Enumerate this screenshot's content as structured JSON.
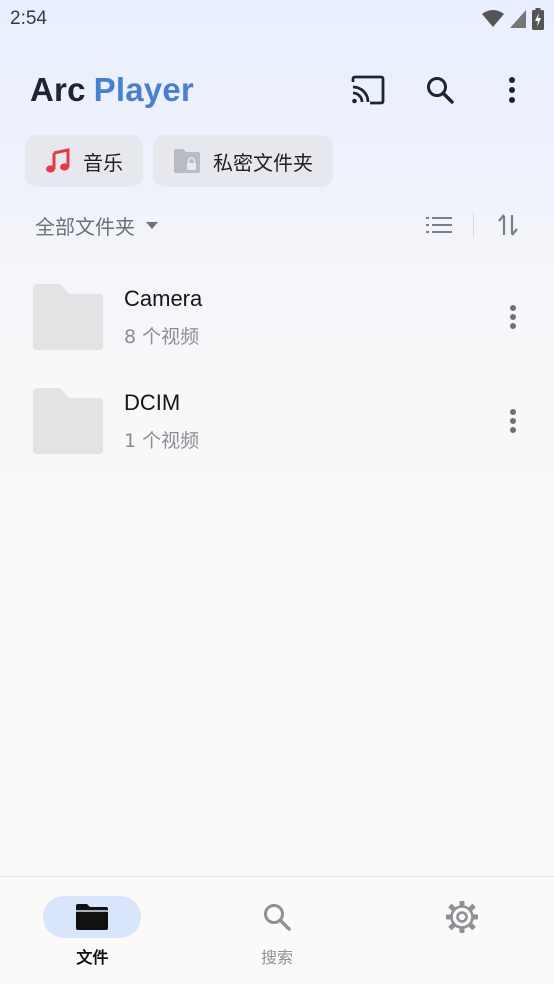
{
  "status_bar": {
    "time": "2:54"
  },
  "header": {
    "title_part1": "Arc",
    "title_part2": "Player"
  },
  "chips": [
    {
      "label": "音乐",
      "icon": "music-note-icon",
      "color": "#e23b4a"
    },
    {
      "label": "私密文件夹",
      "icon": "lock-folder-icon"
    }
  ],
  "filter": {
    "label": "全部文件夹"
  },
  "folders": [
    {
      "name": "Camera",
      "count": "8 个视频"
    },
    {
      "name": "DCIM",
      "count": "1 个视频"
    }
  ],
  "nav": [
    {
      "label": "文件",
      "icon": "folder-icon",
      "active": true
    },
    {
      "label": "搜索",
      "icon": "search-icon",
      "active": false
    },
    {
      "label": "",
      "icon": "settings-icon",
      "active": false
    }
  ],
  "colors": {
    "accent": "#4a7fd0",
    "active_pill": "#d9e5fa",
    "chip_bg": "#e6e8ee"
  }
}
